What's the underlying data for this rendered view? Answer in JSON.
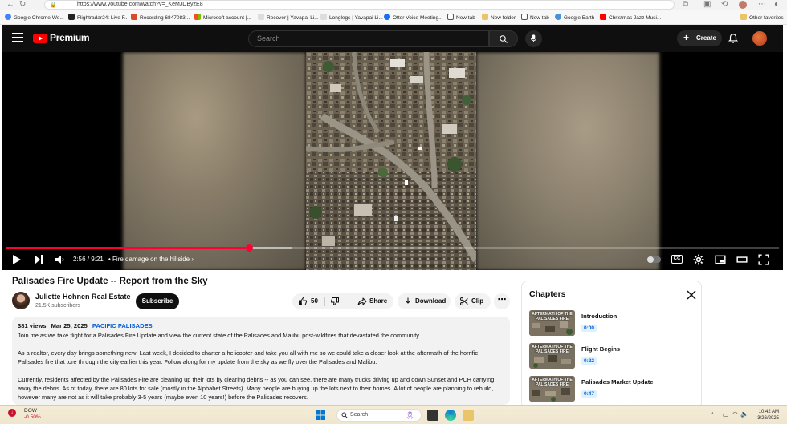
{
  "browser": {
    "url": "https://www.youtube.com/watch?v=_KeMJDByzE8",
    "bookmarks": [
      {
        "label": "Google Chrome We...",
        "color": "#4285f4"
      },
      {
        "label": "Flightradar24: Live F...",
        "color": "#222222"
      },
      {
        "label": "Recording 6847083...",
        "color": "#333333"
      },
      {
        "label": "Microsoft account |...",
        "color": "#f25022"
      },
      {
        "label": "Recover | Yavapai Li...",
        "color": "#e6e6e6"
      },
      {
        "label": "Longlegs | Yavapai Li...",
        "color": "#e6e6e6"
      },
      {
        "label": "Otter Voice Meeting...",
        "color": "#1b6ef3"
      },
      {
        "label": "New tab",
        "color": "#555555"
      },
      {
        "label": "New folder",
        "color": "#555555"
      },
      {
        "label": "New tab",
        "color": "#555555"
      },
      {
        "label": "Google Earth",
        "color": "#4a90d9"
      },
      {
        "label": "Christmas Jazz Musi...",
        "color": "#ff0000"
      }
    ],
    "other_favorites": "Other favorites"
  },
  "header": {
    "logo_text": "Premium",
    "search_placeholder": "Search",
    "create_label": "Create"
  },
  "player": {
    "time_current": "2:56",
    "time_total": "9:21",
    "time_display": "2:56 / 9:21",
    "chapter": "Fire damage on the hillside",
    "progress": 0.314,
    "buffered": 0.37
  },
  "video": {
    "title": "Palisades Fire Update -- Report from the Sky",
    "channel": "Juliette Hohnen Real Estate",
    "subscribers": "21.5K subscribers",
    "subscribe_label": "Subscribe",
    "likes": "50",
    "share_label": "Share",
    "download_label": "Download",
    "clip_label": "Clip"
  },
  "description": {
    "views": "381 views",
    "date": "Mar 25, 2025",
    "tag": "PACIFIC PALISADES",
    "paragraphs": [
      "Join me as we take flight for a Palisades Fire Update and view the current state of the Palisades and Malibu post-wildfires that devastated the community.",
      "As a realtor, every day brings something new! Last week, I decided to charter a helicopter and take you all with me so we could take a closer look at the aftermath of the horrific Palisades fire that tore through the city earlier this year. Follow along for my update from the sky as we fly over the Palisades and Malibu.",
      "Currently, residents affected by the Palisades Fire are cleaning up their lots by clearing debris -- as you can see, there are many trucks driving up and down Sunset and PCH carrying away the debris. As of today, there are 80 lots for sale (mostly in the Alphabet Streets). Many people are buying up the lots next to their homes. A lot of people are planning to rebuild, however many are not as it will take probably 3-5 years (maybe even 10 years!) before the Palisades recovers."
    ]
  },
  "chapters": {
    "title": "Chapters",
    "thumb_label": "AFTERMATH OF THE PALISADES FIRE",
    "items": [
      {
        "name": "Introduction",
        "time": "0:00"
      },
      {
        "name": "Flight Begins",
        "time": "0:22"
      },
      {
        "name": "Palisades Market Update",
        "time": "0:47"
      }
    ]
  },
  "taskbar": {
    "stock_name": "DOW",
    "stock_change": "-0.50%",
    "search_label": "Search",
    "time": "10:42 AM",
    "date": "3/26/2025"
  }
}
